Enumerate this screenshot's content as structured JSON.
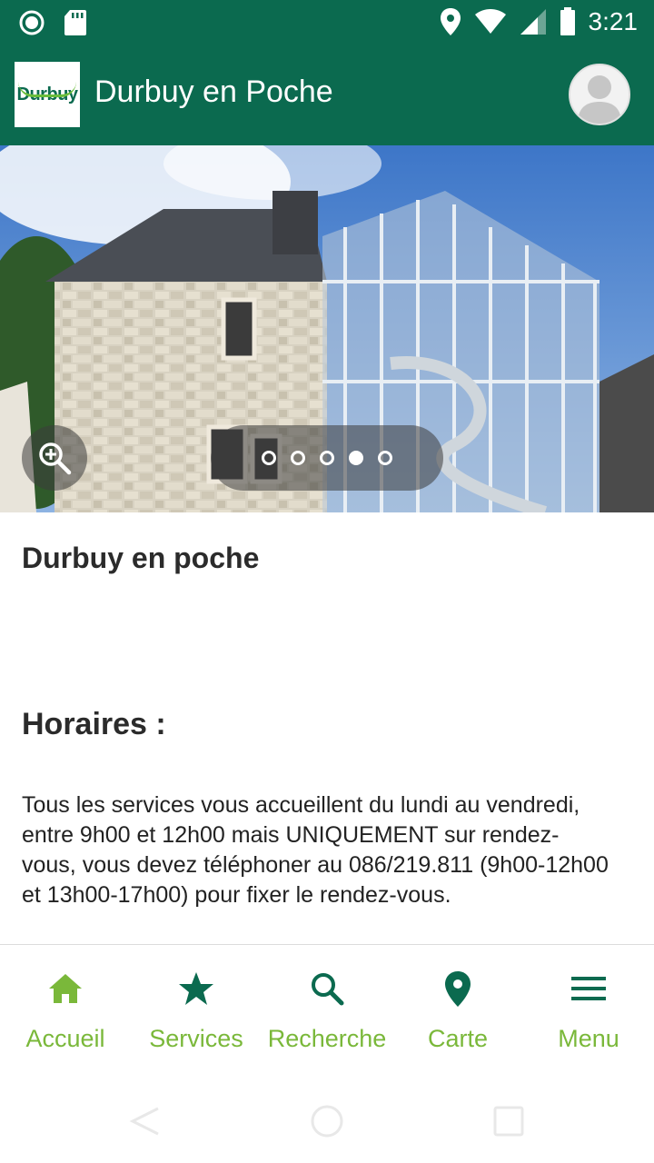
{
  "status_bar": {
    "time": "3:21"
  },
  "app_bar": {
    "logo_text": "Durbuy",
    "title": "Durbuy en Poche"
  },
  "carousel": {
    "slide_count": 5,
    "active_slide": 4
  },
  "content": {
    "heading": "Durbuy en poche",
    "subheading": "Horaires :",
    "paragraph": "Tous les services vous accueillent du lundi au vendredi, entre 9h00 et 12h00 mais UNIQUEMENT sur rendez-vous, vous devez téléphoner au 086/219.811 (9h00-12h00 et 13h00-17h00) pour fixer le rendez-vous."
  },
  "bottom_nav": {
    "items": [
      {
        "label": "Accueil",
        "icon": "home-icon"
      },
      {
        "label": "Services",
        "icon": "star-icon"
      },
      {
        "label": "Recherche",
        "icon": "search-icon"
      },
      {
        "label": "Carte",
        "icon": "map-pin-icon"
      },
      {
        "label": "Menu",
        "icon": "menu-icon"
      }
    ]
  },
  "colors": {
    "primary": "#0b6a4f",
    "accent": "#7ab83a"
  }
}
